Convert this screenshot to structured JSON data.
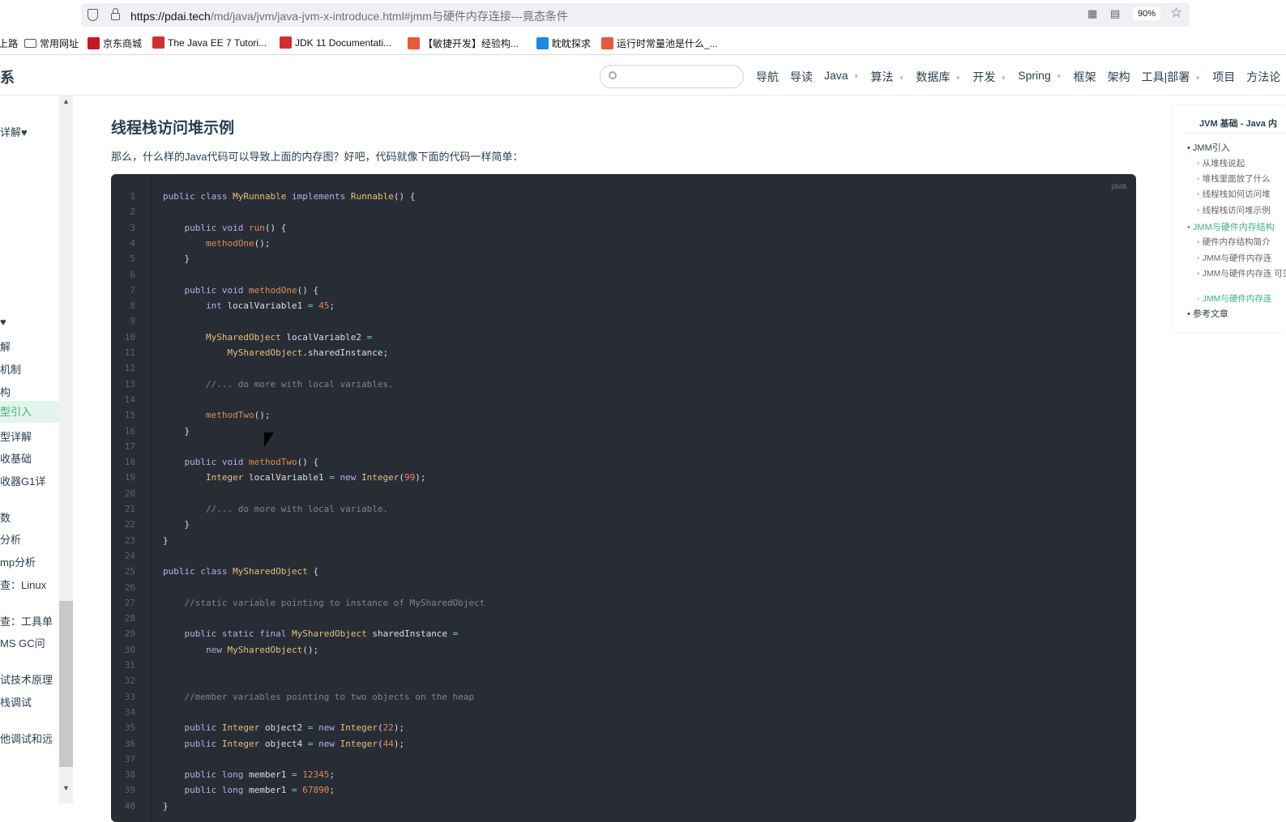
{
  "browser": {
    "url_host": "https://pdai.tech",
    "url_path": "/md/java/jvm/java-jvm-x-introduce.html#jmm与硬件内存连接---竟态条件",
    "zoom": "90%"
  },
  "bookmarks": [
    {
      "label": "上路",
      "icon": "none"
    },
    {
      "label": "常用网址",
      "icon": "folder-icon"
    },
    {
      "label": "京东商城",
      "icon": "jd-icon",
      "color": "#c91623"
    },
    {
      "label": "The Java EE 7 Tutori...",
      "icon": "oracle-icon",
      "color": "#d32f2f"
    },
    {
      "label": "JDK 11 Documentati...",
      "icon": "oracle-icon",
      "color": "#d32f2f"
    },
    {
      "label": "【敏捷开发】经验构...",
      "icon": "csdn-icon",
      "color": "#e8583a"
    },
    {
      "label": "眈眈探求",
      "icon": "blue-swirl-icon",
      "color": "#1e88e5"
    },
    {
      "label": "运行时常量池是什么_...",
      "icon": "csdn-icon",
      "color": "#e8583a"
    }
  ],
  "site": {
    "logo": "系",
    "nav": [
      {
        "label": "导航",
        "caret": false
      },
      {
        "label": "导读",
        "caret": false
      },
      {
        "label": "Java",
        "caret": true
      },
      {
        "label": "算法",
        "caret": true
      },
      {
        "label": "数据库",
        "caret": true
      },
      {
        "label": "开发",
        "caret": true
      },
      {
        "label": "Spring",
        "caret": true
      },
      {
        "label": "框架",
        "caret": false
      },
      {
        "label": "架构",
        "caret": false
      },
      {
        "label": "工具|部署",
        "caret": true
      },
      {
        "label": "项目",
        "caret": false
      },
      {
        "label": "方法论",
        "caret": false
      }
    ]
  },
  "sidebar": {
    "items": [
      "详解♥",
      "♥",
      "解",
      "机制",
      "构",
      "型引入",
      "型详解",
      "收基础",
      "收器G1详",
      "数",
      "分析",
      "mp分析",
      "查：Linux",
      "查：工具单",
      "MS GC问",
      "试技术原理",
      "栈调试",
      "他调试和远"
    ],
    "active_index": 5
  },
  "main": {
    "heading": "线程栈访问堆示例",
    "intro": "那么，什么样的Java代码可以导致上面的内存图？好吧，代码就像下面的代码一样简单：",
    "code_lang": "java",
    "code": [
      "public class MyRunnable implements Runnable() {",
      "",
      "    public void run() {",
      "        methodOne();",
      "    }",
      "",
      "    public void methodOne() {",
      "        int localVariable1 = 45;",
      "",
      "        MySharedObject localVariable2 =",
      "            MySharedObject.sharedInstance;",
      "",
      "        //... do more with local variables.",
      "",
      "        methodTwo();",
      "    }",
      "",
      "    public void methodTwo() {",
      "        Integer localVariable1 = new Integer(99);",
      "",
      "        //... do more with local variable.",
      "    }",
      "}",
      "",
      "public class MySharedObject {",
      "",
      "    //static variable pointing to instance of MySharedObject",
      "",
      "    public static final MySharedObject sharedInstance =",
      "        new MySharedObject();",
      "",
      "",
      "    //member variables pointing to two objects on the heap",
      "",
      "    public Integer object2 = new Integer(22);",
      "    public Integer object4 = new Integer(44);",
      "",
      "    public long member1 = 12345;",
      "    public long member1 = 67890;",
      "}"
    ]
  },
  "toc": {
    "title": "JVM 基础 - Java 内",
    "items": [
      {
        "label": "JMM引入",
        "level": 1
      },
      {
        "label": "从堆栈说起",
        "level": 2
      },
      {
        "label": "堆栈里面放了什么",
        "level": 2
      },
      {
        "label": "线程栈如何访问堆",
        "level": 2
      },
      {
        "label": "线程栈访问堆示例",
        "level": 2
      },
      {
        "label": "JMM与硬件内存结构",
        "level": 1,
        "active": true
      },
      {
        "label": "硬件内存结构简介",
        "level": 2
      },
      {
        "label": "JMM与硬件内存连",
        "level": 2
      },
      {
        "label": "JMM与硬件内存连 可见性",
        "level": 2
      },
      {
        "label": "JMM与硬件内存连",
        "level": 2,
        "active": true
      },
      {
        "label": "参考文章",
        "level": 1
      }
    ]
  }
}
